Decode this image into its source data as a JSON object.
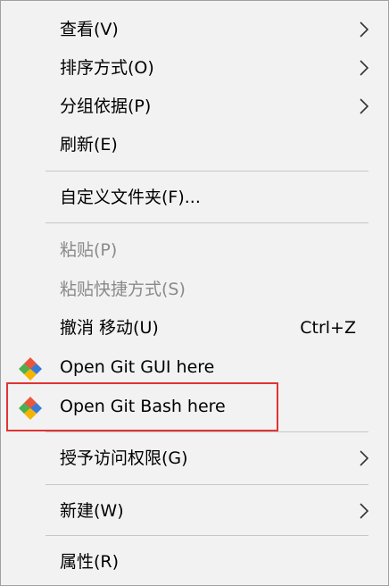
{
  "menu": {
    "items": [
      {
        "label": "查看(V)",
        "submenu": true
      },
      {
        "label": "排序方式(O)",
        "submenu": true
      },
      {
        "label": "分组依据(P)",
        "submenu": true
      },
      {
        "label": "刷新(E)"
      },
      {
        "label": "自定义文件夹(F)..."
      },
      {
        "label": "粘贴(P)",
        "disabled": true
      },
      {
        "label": "粘贴快捷方式(S)",
        "disabled": true
      },
      {
        "label": "撤消 移动(U)",
        "shortcut": "Ctrl+Z"
      },
      {
        "label": "Open Git GUI here",
        "icon": "git-icon"
      },
      {
        "label": "Open Git Bash here",
        "icon": "git-icon",
        "highlighted": true
      },
      {
        "label": "授予访问权限(G)",
        "submenu": true
      },
      {
        "label": "新建(W)",
        "submenu": true
      },
      {
        "label": "属性(R)"
      }
    ]
  },
  "colors": {
    "background": "#f2f2f2",
    "text": "#000000",
    "disabled_text": "#8a8a8a",
    "separator": "#c7c7c7",
    "highlight_border": "#e03434"
  }
}
